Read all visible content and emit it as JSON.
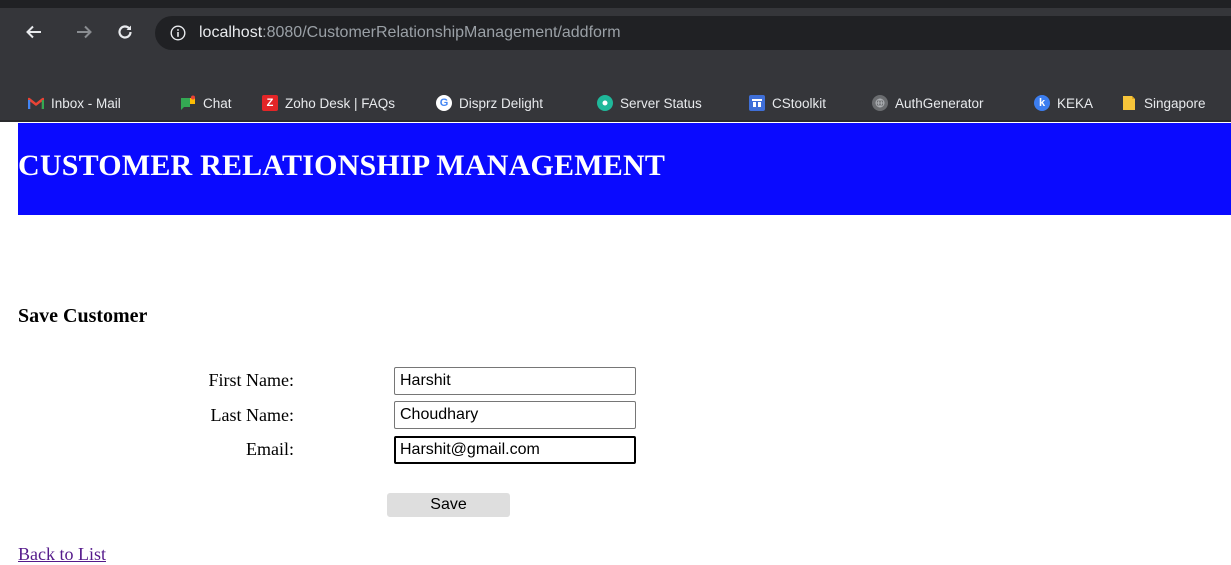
{
  "browser": {
    "url_host": "localhost",
    "url_path": ":8080/CustomerRelationshipManagement/addform",
    "bookmarks": [
      {
        "label": "Inbox - Mail",
        "icon": "gmail-icon"
      },
      {
        "label": "Chat",
        "icon": "chat-icon"
      },
      {
        "label": "Zoho Desk | FAQs",
        "icon": "zoho-icon"
      },
      {
        "label": "Disprz Delight",
        "icon": "google-icon"
      },
      {
        "label": "Server Status",
        "icon": "server-status-icon"
      },
      {
        "label": "CStoolkit",
        "icon": "cstoolkit-icon"
      },
      {
        "label": "AuthGenerator",
        "icon": "globe-icon"
      },
      {
        "label": "KEKA",
        "icon": "keka-icon"
      },
      {
        "label": "Singapore",
        "icon": "folder-icon"
      }
    ]
  },
  "header": {
    "title": "CUSTOMER RELATIONSHIP MANAGEMENT",
    "color": "#0a0aff"
  },
  "form": {
    "title": "Save Customer",
    "first_name_label": "First Name:",
    "first_name_value": "Harshit",
    "last_name_label": "Last Name:",
    "last_name_value": "Choudhary",
    "email_label": "Email:",
    "email_value": "Harshit@gmail.com",
    "save_label": "Save"
  },
  "back_link": "Back to List"
}
